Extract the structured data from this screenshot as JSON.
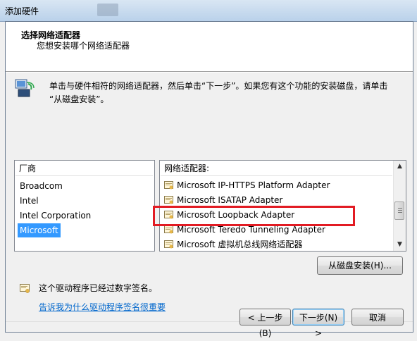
{
  "window": {
    "title": "添加硬件"
  },
  "header": {
    "title": "选择网络适配器",
    "subtitle": "您想安装哪个网络适配器"
  },
  "description": {
    "line1": "单击与硬件相符的网络适配器，然后单击“下一步”。如果您有这个功能的安装磁盘，请单击",
    "line2": "“从磁盘安装”。"
  },
  "vendor_list": {
    "header": "厂商",
    "items": [
      "Broadcom",
      "Intel",
      "Intel Corporation",
      "Microsoft"
    ],
    "selected": "Microsoft"
  },
  "adapter_list": {
    "header": "网络适配器:",
    "items": [
      "Microsoft IP-HTTPS Platform Adapter",
      "Microsoft ISATAP Adapter",
      "Microsoft Loopback Adapter",
      "Microsoft Teredo Tunneling Adapter",
      "Microsoft 虚拟机总线网络适配器"
    ],
    "highlighted": "Microsoft Loopback Adapter"
  },
  "signature": {
    "text": "这个驱动程序已经过数字签名。",
    "link": "告诉我为什么驱动程序签名很重要"
  },
  "buttons": {
    "have_disk": "从磁盘安装(H)...",
    "back": "< 上一步(B)",
    "next": "下一步(N) >",
    "cancel": "取消"
  },
  "colors": {
    "selection": "#3399ff",
    "highlight_box": "#e21b23",
    "link": "#0066cc"
  },
  "icons": [
    "network-adapter-icon",
    "driver-signed-icon",
    "adapter-item-icon"
  ]
}
